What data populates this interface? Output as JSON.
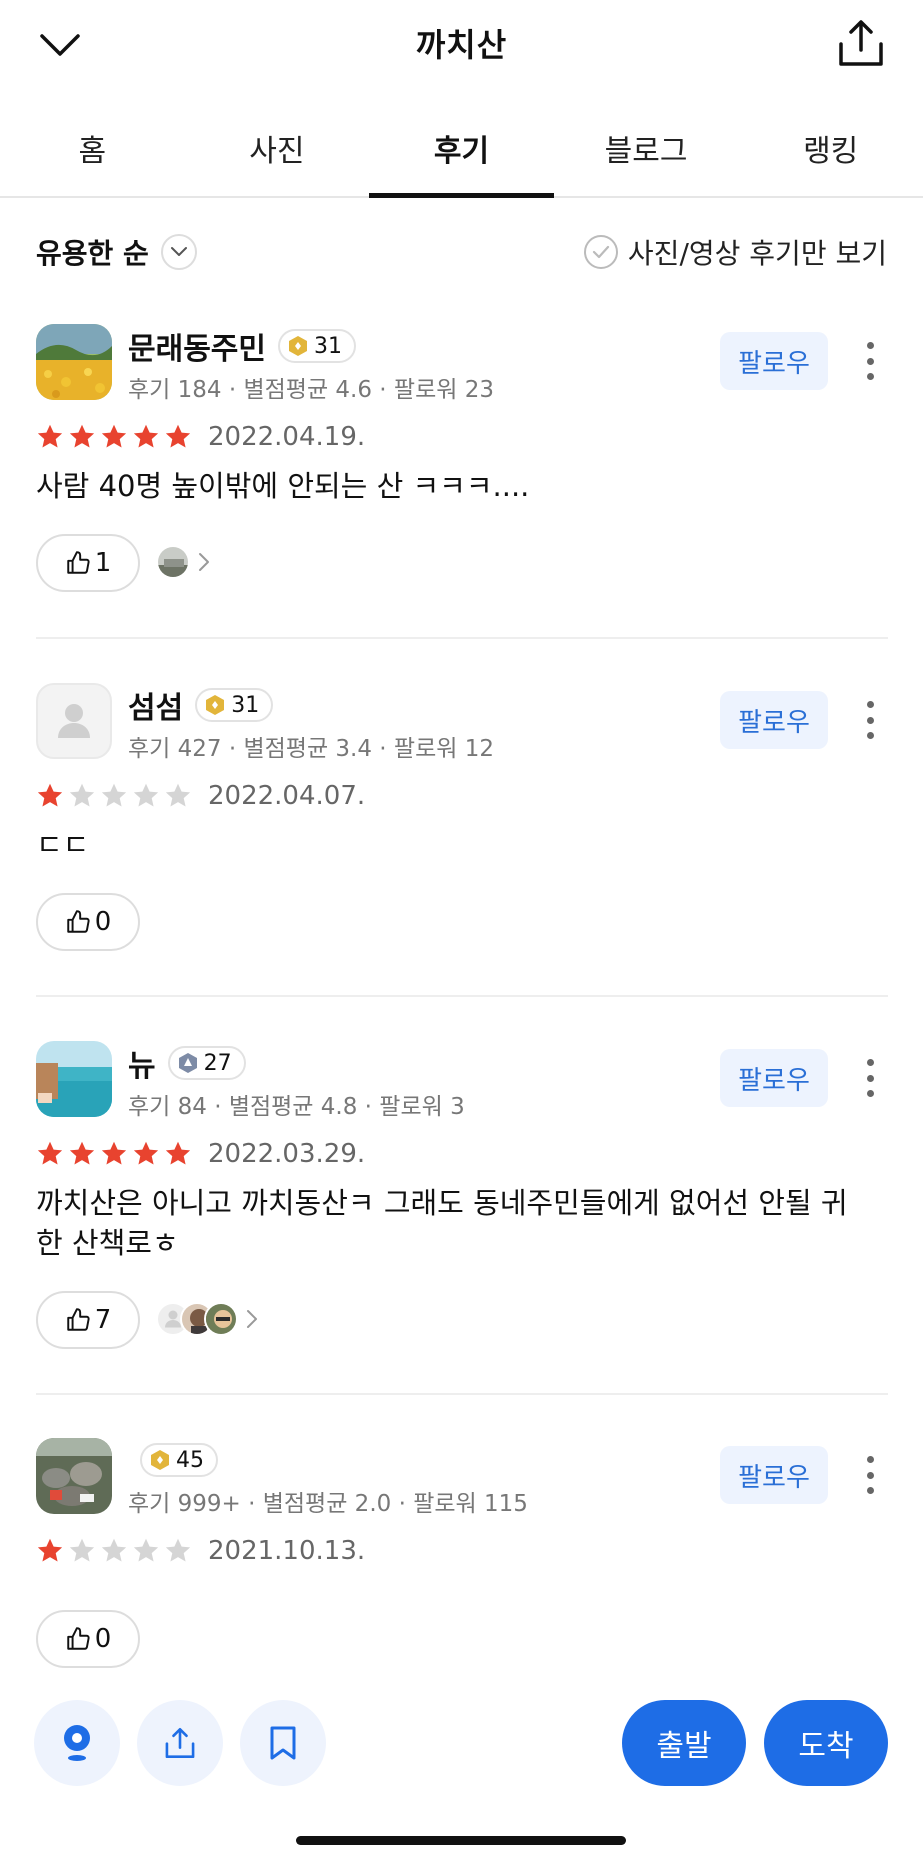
{
  "header": {
    "title": "까치산"
  },
  "tabs": [
    {
      "label": "홈",
      "active": false
    },
    {
      "label": "사진",
      "active": false
    },
    {
      "label": "후기",
      "active": true
    },
    {
      "label": "블로그",
      "active": false
    },
    {
      "label": "랭킹",
      "active": false
    }
  ],
  "filters": {
    "sort_label": "유용한 순",
    "photo_only_label": "사진/영상 후기만 보기"
  },
  "reviews": [
    {
      "name": "문래동주민",
      "level": "31",
      "level_icon": "gold-badge-icon",
      "stats": "후기 184 · 별점평균 4.6 · 팔로워 23",
      "follow_label": "팔로우",
      "rating": 5,
      "date": "2022.04.19.",
      "text": "사람 40명 높이밖에 안되는 산 ㅋㅋㅋ....",
      "likes": "1",
      "avatar": "flower-field-photo"
    },
    {
      "name": "섬섬",
      "level": "31",
      "level_icon": "gold-badge-icon",
      "stats": "후기 427 · 별점평균 3.4 · 팔로워 12",
      "follow_label": "팔로우",
      "rating": 1,
      "date": "2022.04.07.",
      "text": "ㄷㄷ",
      "likes": "0",
      "avatar": "default-person"
    },
    {
      "name": "뉴",
      "level": "27",
      "level_icon": "silver-badge-icon",
      "stats": "후기 84 · 별점평균 4.8 · 팔로워 3",
      "follow_label": "팔로우",
      "rating": 5,
      "date": "2022.03.29.",
      "text": "까치산은 아니고 까치동산ㅋ 그래도 동네주민들에게 없어선 안될 귀한 산책로ㅎ",
      "likes": "7",
      "avatar": "sea-photo"
    },
    {
      "name": "",
      "level": "45",
      "level_icon": "gold-badge-icon",
      "stats": "후기 999+ · 별점평균 2.0 · 팔로워 115",
      "follow_label": "팔로우",
      "rating": 1,
      "date": "2021.10.13.",
      "text": "",
      "likes": "0",
      "avatar": "stone-wall-photo"
    }
  ],
  "bottom": {
    "depart_label": "출발",
    "arrive_label": "도착"
  },
  "colors": {
    "accent": "#1e6de6",
    "star": "#e8432f",
    "star_empty": "#d5d5d5",
    "follow_text": "#2a6fd6"
  }
}
